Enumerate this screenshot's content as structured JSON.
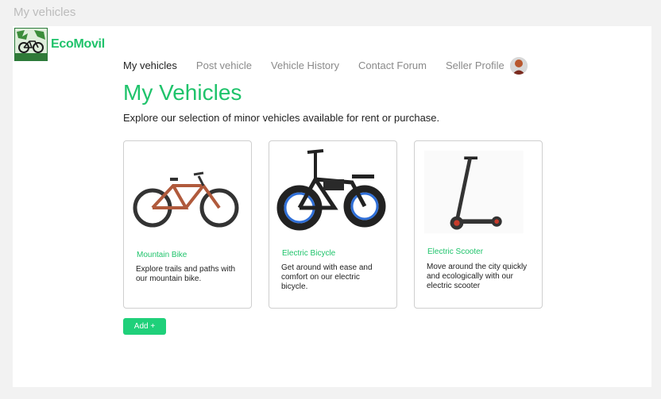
{
  "window": {
    "title": "My vehicles"
  },
  "brand": {
    "name": "EcoMovil",
    "badge_text": "ECO MOVIL"
  },
  "nav": {
    "items": [
      "My vehicles",
      "Post vehicle",
      "Vehicle History",
      "Contact Forum",
      "Seller Profile"
    ],
    "active_index": 0
  },
  "page": {
    "title": "My Vehicles",
    "subtitle": "Explore our selection of minor vehicles available for rent or purchase."
  },
  "cards": [
    {
      "title": "Mountain Bike",
      "description": "Explore trails and paths with our mountain bike.",
      "image_icon": "mountain-bike-image"
    },
    {
      "title": "Electric Bicycle",
      "description": "Get around with ease and comfort on our electric bicycle.",
      "image_icon": "electric-bicycle-image"
    },
    {
      "title": "Electric Scooter",
      "description": "Move around the city quickly and ecologically with our electric scooter",
      "image_icon": "electric-scooter-image"
    }
  ],
  "actions": {
    "add_label": "Add +"
  },
  "colors": {
    "accent": "#1fc36b",
    "button": "#1fd07a"
  }
}
